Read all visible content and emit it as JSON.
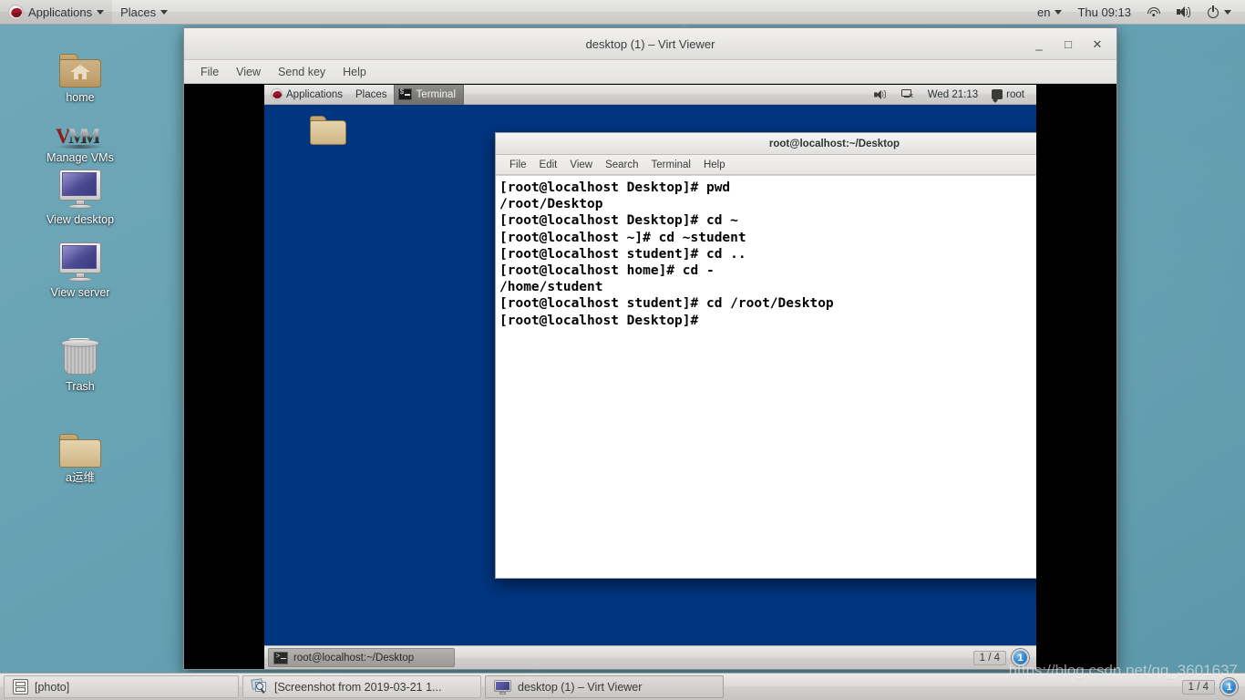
{
  "host": {
    "top_panel": {
      "applications_label": "Applications",
      "places_label": "Places",
      "keyboard_layout": "en",
      "clock": "Thu 09:13",
      "icons": [
        "redhat-logo",
        "wifi-icon",
        "volume-icon",
        "power-icon"
      ]
    },
    "desktop_icons": [
      {
        "label": "home",
        "icon": "home-folder-icon"
      },
      {
        "label": "Manage VMs",
        "icon": "vmm-logo-icon"
      },
      {
        "label": "View desktop",
        "icon": "monitor-icon"
      },
      {
        "label": "View server",
        "icon": "monitor-icon"
      },
      {
        "label": "Trash",
        "icon": "trash-icon"
      },
      {
        "label": "a运维",
        "icon": "folder-icon"
      }
    ],
    "taskbar": {
      "items": [
        {
          "label": "[photo]",
          "icon": "archive-icon"
        },
        {
          "label": "[Screenshot from 2019-03-21 1...",
          "icon": "screenshot-icon"
        },
        {
          "label": "desktop (1) – Virt Viewer",
          "icon": "monitor-icon"
        }
      ],
      "workspace_count": "1 / 4",
      "workspace_current": "1"
    },
    "watermark": "https://blog.csdn.net/qq_3601637"
  },
  "virt_viewer": {
    "title": "desktop (1) – Virt Viewer",
    "menu": [
      "File",
      "View",
      "Send key",
      "Help"
    ],
    "window_buttons": {
      "minimize": "_",
      "maximize": "□",
      "close": "✕"
    }
  },
  "guest": {
    "top_panel": {
      "applications_label": "Applications",
      "places_label": "Places",
      "active_task": "Terminal",
      "clock": "Wed 21:13",
      "user": "root",
      "icons": [
        "redhat-logo",
        "terminal-icon",
        "volume-icon",
        "network-icon",
        "user-icon"
      ]
    },
    "terminal": {
      "title": "root@localhost:~/Desktop",
      "menu": [
        "File",
        "Edit",
        "View",
        "Search",
        "Terminal",
        "Help"
      ],
      "window_buttons": {
        "minimize": "_",
        "maximize": "□",
        "close": "✕"
      },
      "content": "[root@localhost Desktop]# pwd\n/root/Desktop\n[root@localhost Desktop]# cd ~\n[root@localhost ~]# cd ~student\n[root@localhost student]# cd ..\n[root@localhost home]# cd -\n/home/student\n[root@localhost student]# cd /root/Desktop\n[root@localhost Desktop]# "
    },
    "taskbar": {
      "task_label": "root@localhost:~/Desktop",
      "workspace_count": "1 / 4",
      "workspace_current": "1"
    }
  },
  "colors": {
    "host_desktop": "#68a3b4",
    "guest_desktop": "#003580",
    "panel": "#dddcda",
    "accent_blue": "#3e8fd6"
  }
}
